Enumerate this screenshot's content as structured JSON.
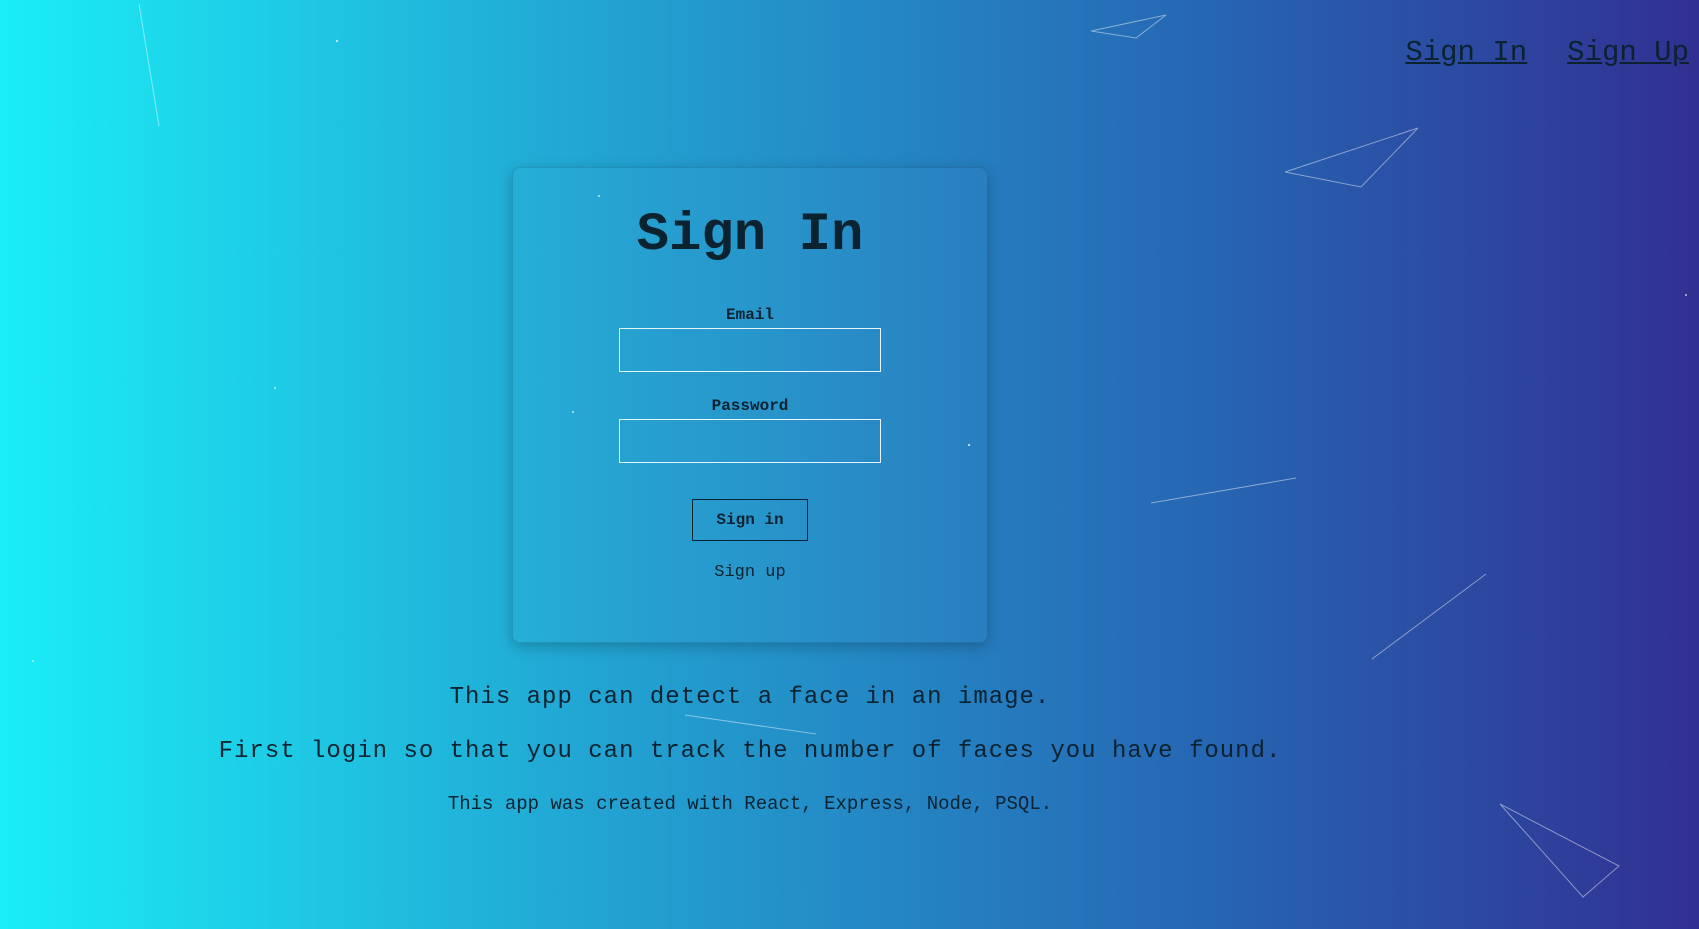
{
  "nav": {
    "sign_in": "Sign In",
    "sign_up": "Sign Up"
  },
  "form": {
    "title": "Sign In",
    "email_label": "Email",
    "email_value": "",
    "password_label": "Password",
    "password_value": "",
    "submit_label": "Sign in",
    "signup_link": "Sign up"
  },
  "info": {
    "line1": "This app can detect a face in an image.",
    "line2": "First login so that you can track the number of faces you have found.",
    "line3": "This app was created with React, Express, Node, PSQL."
  },
  "colors": {
    "gradient_start": "#1aeef6",
    "gradient_end": "#313092",
    "text": "#0b2230"
  }
}
